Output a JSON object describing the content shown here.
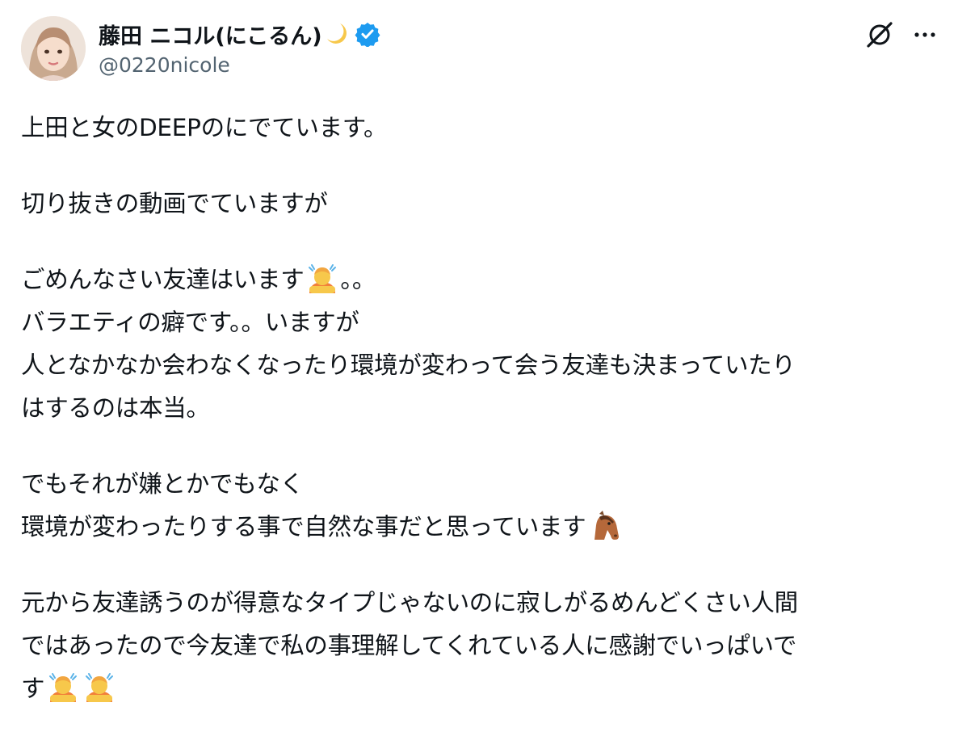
{
  "author": {
    "display_name": "藤田 ニコル(にこるん)",
    "name_emoji": "crescent-moon-icon",
    "verified_badge": "verified-icon",
    "handle": "@0220nicole",
    "avatar": "profile-photo"
  },
  "actions": {
    "grok_icon": "grok-icon",
    "more_icon": "more-icon"
  },
  "tweet": {
    "line1": "上田と女のDEEPのにでています。",
    "line2": "切り抜きの動画でていますが",
    "line3a": "ごめんなさい友達はいます",
    "line3_emoji": "person-bowing-icon",
    "line3b": "。。",
    "line4": "バラエティの癖です。。いますが",
    "line5": "人となかなか会わなくなったり環境が変わって会う友達も決まっていたり",
    "line6": "はするのは本当。",
    "line7": "でもそれが嫌とかでもなく",
    "line8": "環境が変わったりする事で自然な事だと思っています",
    "line8_emoji": "horse-face-icon",
    "line9": "元から友達誘うのが得意なタイプじゃないのに寂しがるめんどくさい人間",
    "line10": "ではあったので今友達で私の事理解してくれている人に感謝でいっぱいで",
    "line11": "す",
    "line11_emojis": [
      "person-bowing-icon",
      "person-bowing-icon"
    ]
  },
  "colors": {
    "text": "#0f1419",
    "secondary": "#536471",
    "verified": "#1d9bf0",
    "background": "#ffffff"
  }
}
